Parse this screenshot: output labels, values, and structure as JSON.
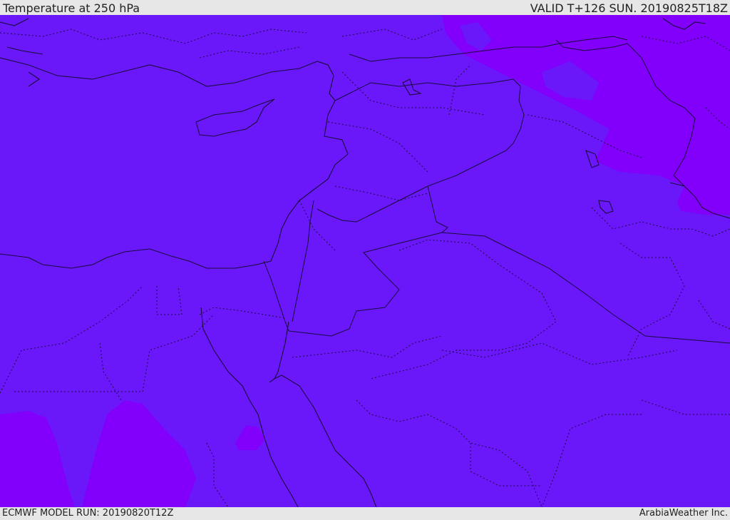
{
  "header": {
    "title": "Temperature at 250 hPa",
    "valid": "VALID T+126 SUN. 20190825T18Z"
  },
  "footer": {
    "model_run": "ECMWF MODEL RUN: 20190820T12Z",
    "credit": "ArabiaWeather Inc."
  },
  "map": {
    "base_color": "#6a18fa",
    "warm_pocket_color": "#8200fb",
    "coastline_color": "#1a0a3c",
    "border_style": "solid",
    "admin_border_style": "dotted"
  }
}
